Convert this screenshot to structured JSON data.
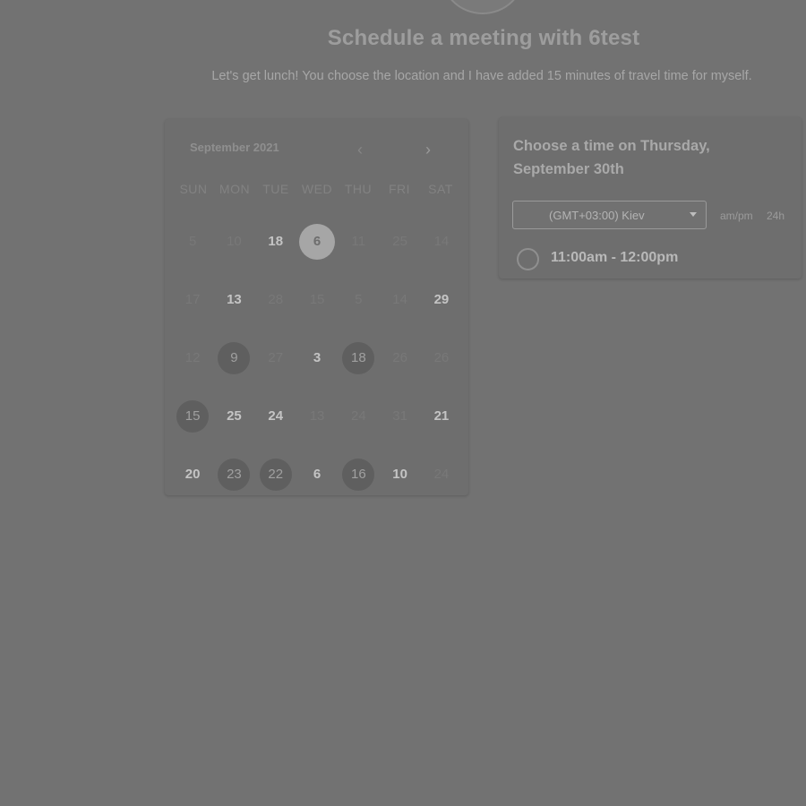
{
  "header": {
    "title": "Schedule a meeting with 6test",
    "subtitle": "Let's get lunch! You choose the location and I have added 15 minutes of travel time for myself."
  },
  "calendar": {
    "month_label": "September 2021",
    "prev_icon": "chevron-left-icon",
    "next_icon": "chevron-right-icon",
    "weekdays": [
      "SUN",
      "MON",
      "TUE",
      "WED",
      "THU",
      "FRI",
      "SAT"
    ],
    "days": [
      {
        "label": "5",
        "available": false
      },
      {
        "label": "10",
        "available": false
      },
      {
        "label": "18",
        "available": true
      },
      {
        "label": "6",
        "available": true,
        "selected": true
      },
      {
        "label": "11",
        "available": false
      },
      {
        "label": "25",
        "available": false
      },
      {
        "label": "14",
        "available": false
      },
      {
        "label": "17",
        "available": false
      },
      {
        "label": "13",
        "available": true
      },
      {
        "label": "28",
        "available": false
      },
      {
        "label": "15",
        "available": false
      },
      {
        "label": "5",
        "available": false
      },
      {
        "label": "14",
        "available": false
      },
      {
        "label": "29",
        "available": true
      },
      {
        "label": "12",
        "available": false
      },
      {
        "label": "9",
        "available": false,
        "highlight": true
      },
      {
        "label": "27",
        "available": false
      },
      {
        "label": "3",
        "available": true
      },
      {
        "label": "18",
        "available": false,
        "highlight": true
      },
      {
        "label": "26",
        "available": false
      },
      {
        "label": "26",
        "available": false
      },
      {
        "label": "15",
        "available": false,
        "highlight": true
      },
      {
        "label": "25",
        "available": true
      },
      {
        "label": "24",
        "available": true
      },
      {
        "label": "13",
        "available": false
      },
      {
        "label": "24",
        "available": false
      },
      {
        "label": "31",
        "available": false
      },
      {
        "label": "21",
        "available": true
      },
      {
        "label": "20",
        "available": true
      },
      {
        "label": "23",
        "available": false,
        "highlight": true
      },
      {
        "label": "22",
        "available": false,
        "highlight": true
      },
      {
        "label": "6",
        "available": true
      },
      {
        "label": "16",
        "available": false,
        "highlight": true
      },
      {
        "label": "10",
        "available": true
      },
      {
        "label": "24",
        "available": false
      }
    ]
  },
  "time_panel": {
    "heading": "Choose a time on Thursday, September 30th",
    "timezone": {
      "value": "(GMT+03:00) Kiev",
      "icon": "caret-down-icon"
    },
    "format_ampm": "am/pm",
    "format_24h": "24h",
    "slots": [
      {
        "label": "11:00am - 12:00pm"
      }
    ]
  }
}
